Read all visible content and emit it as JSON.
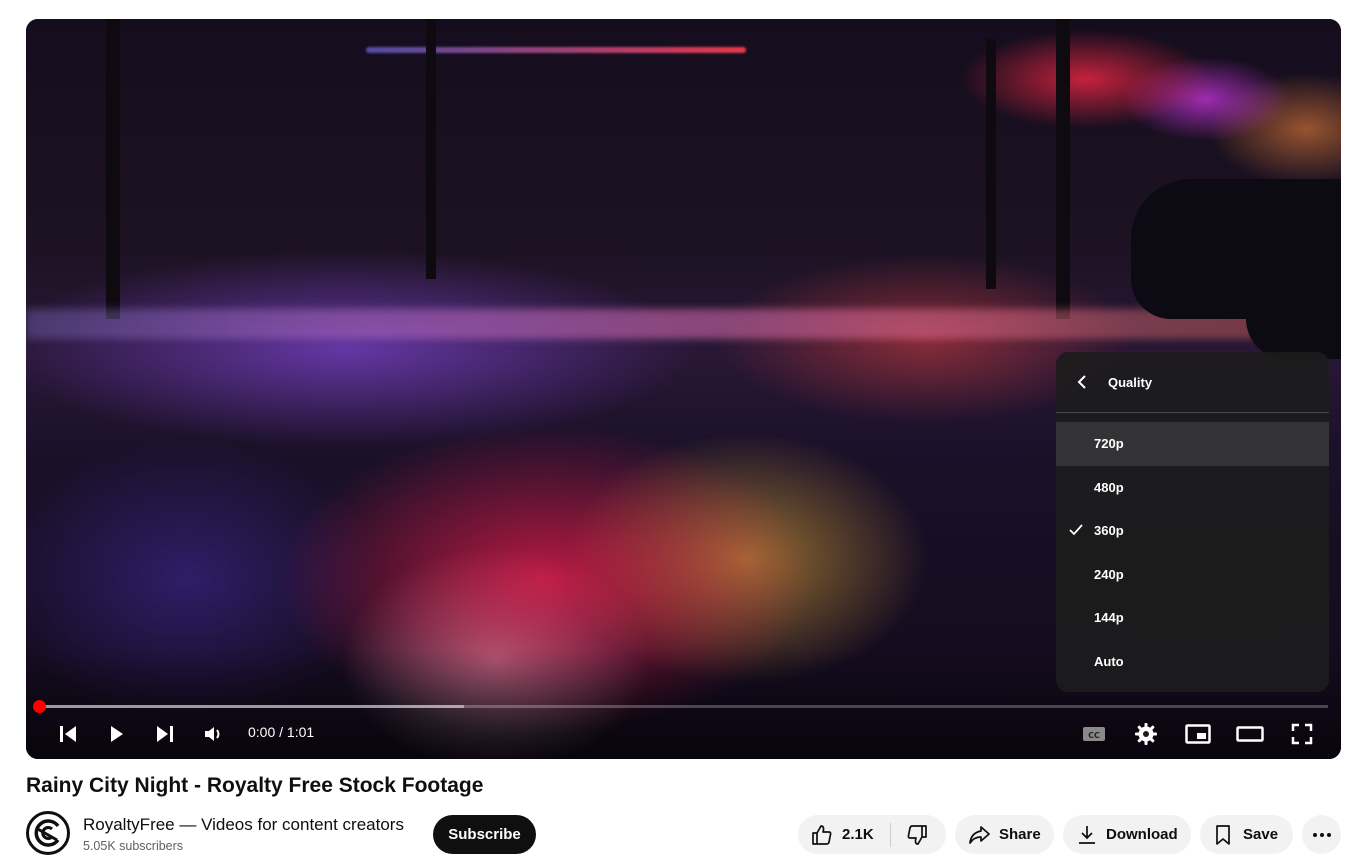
{
  "player": {
    "time_display": "0:00 / 1:01",
    "progress": {
      "buffered_fraction": 0.33,
      "played_fraction": 0.0
    },
    "accent_color": "#ff0000",
    "controls": {
      "left": [
        "previous-icon",
        "play-icon",
        "next-icon",
        "volume-icon"
      ],
      "right": [
        "captions-icon",
        "settings-gear-icon",
        "miniplayer-icon",
        "theater-mode-icon",
        "fullscreen-icon"
      ]
    },
    "quality_menu": {
      "title": "Quality",
      "options": [
        {
          "label": "720p",
          "selected": false,
          "hovered": true
        },
        {
          "label": "480p",
          "selected": false,
          "hovered": false
        },
        {
          "label": "360p",
          "selected": true,
          "hovered": false
        },
        {
          "label": "240p",
          "selected": false,
          "hovered": false
        },
        {
          "label": "144p",
          "selected": false,
          "hovered": false
        },
        {
          "label": "Auto",
          "selected": false,
          "hovered": false
        }
      ]
    }
  },
  "video": {
    "title": "Rainy City Night - Royalty Free Stock Footage"
  },
  "channel": {
    "name": "RoyaltyFree — Videos for content creators",
    "subscribers": "5.05K subscribers",
    "subscribe_label": "Subscribe"
  },
  "actions": {
    "likes": "2.1K",
    "share_label": "Share",
    "download_label": "Download",
    "save_label": "Save"
  }
}
